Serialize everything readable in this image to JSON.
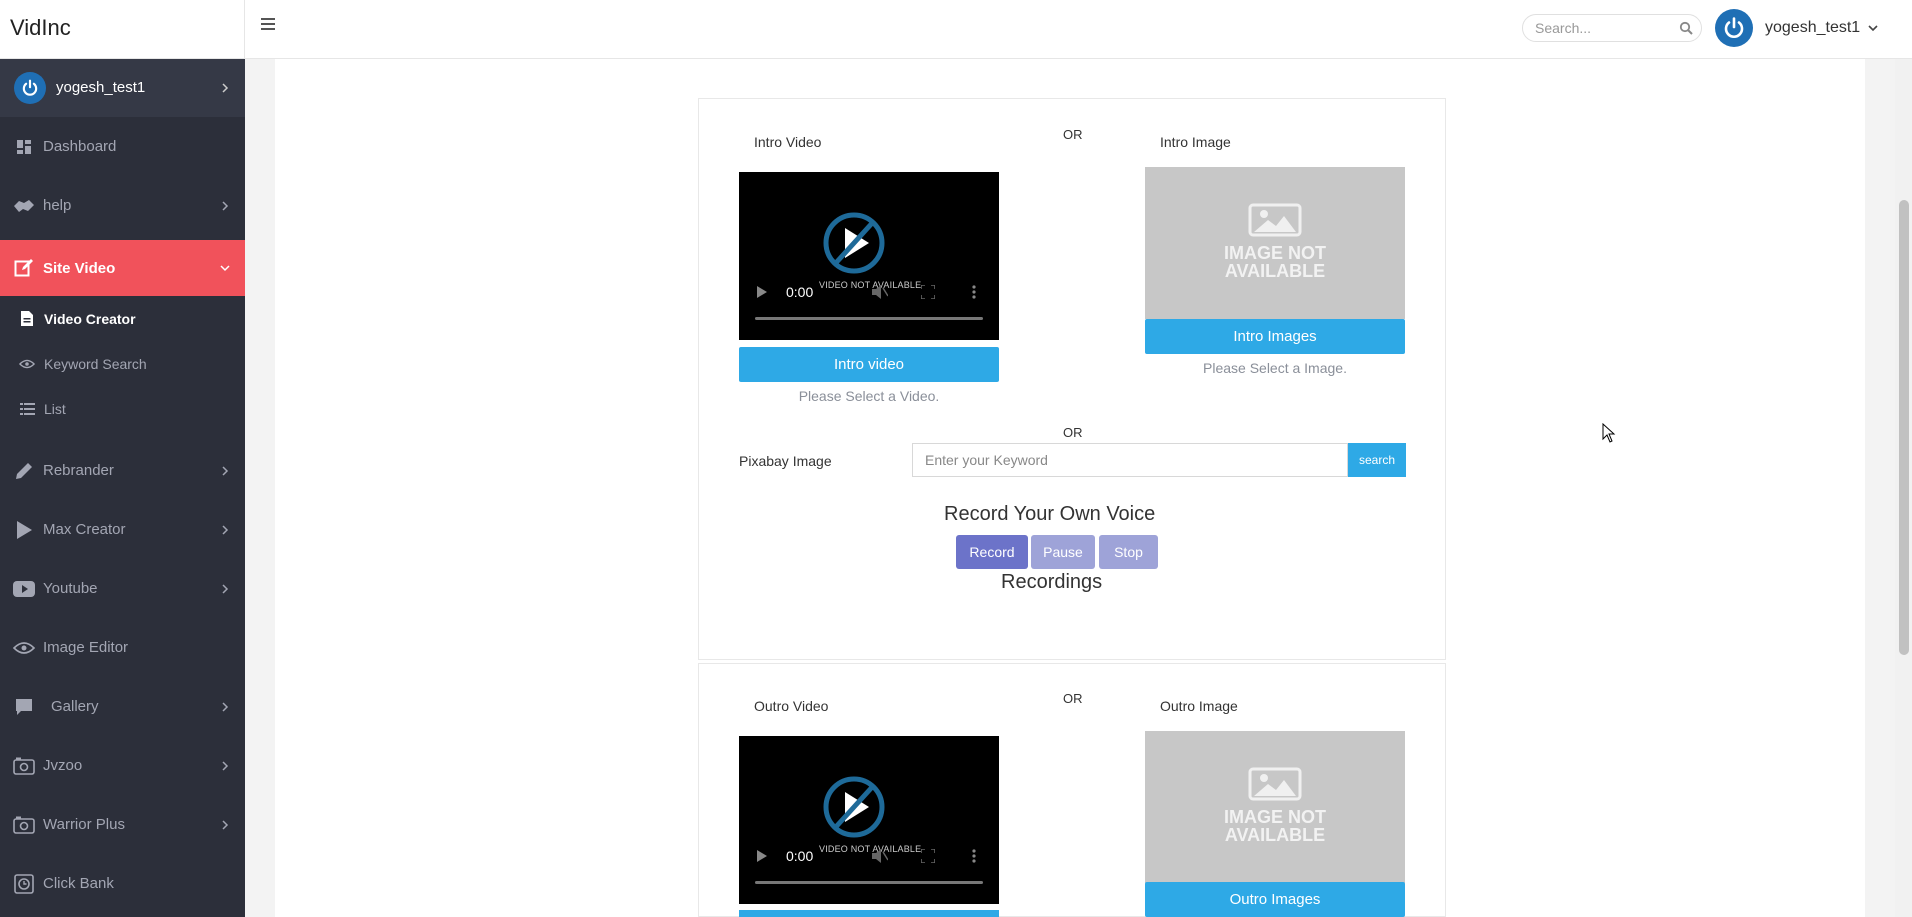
{
  "app": {
    "brand": "VidInc"
  },
  "topbar": {
    "search_placeholder": "Search...",
    "username": "yogesh_test1"
  },
  "sidebar": {
    "user": "yogesh_test1",
    "items": [
      {
        "label": "Dashboard",
        "icon": "dashboard-icon"
      },
      {
        "label": "help",
        "icon": "handshake-icon"
      },
      {
        "label": "Site Video",
        "icon": "edit-icon",
        "active": true
      },
      {
        "label": "Rebrander",
        "icon": "pencil-icon"
      },
      {
        "label": "Max Creator",
        "icon": "play-icon"
      },
      {
        "label": "Youtube",
        "icon": "youtube-icon"
      },
      {
        "label": "Image Editor",
        "icon": "eye-icon"
      },
      {
        "label": "Gallery",
        "icon": "comment-icon"
      },
      {
        "label": "Jvzoo",
        "icon": "camera-icon"
      },
      {
        "label": "Warrior Plus",
        "icon": "camera-icon"
      },
      {
        "label": "Click Bank",
        "icon": "clock-icon"
      }
    ],
    "subitems": [
      {
        "label": "Video Creator",
        "icon": "file-icon",
        "current": true
      },
      {
        "label": "Keyword Search",
        "icon": "eye-icon"
      },
      {
        "label": "List",
        "icon": "list-icon"
      }
    ]
  },
  "intro": {
    "video_label": "Intro Video",
    "or_top": "OR",
    "image_label": "Intro Image",
    "video_time": "0:00",
    "video_na": "VIDEO NOT AVAILABLE",
    "image_na_line1": "IMAGE NOT",
    "image_na_line2": "AVAILABLE",
    "video_button": "Intro video",
    "image_button": "Intro Images",
    "video_hint": "Please Select a Video.",
    "image_hint": "Please Select a Image.",
    "or_mid": "OR",
    "pixabay_label": "Pixabay Image",
    "keyword_placeholder": "Enter your Keyword",
    "search_button": "search",
    "voice_heading": "Record Your Own Voice",
    "record": "Record",
    "pause": "Pause",
    "stop": "Stop",
    "recordings": "Recordings"
  },
  "outro": {
    "video_label": "Outro Video",
    "or_top": "OR",
    "image_label": "Outro Image",
    "video_time": "0:00",
    "video_na": "VIDEO NOT AVAILABLE",
    "image_na_line1": "IMAGE NOT",
    "image_na_line2": "AVAILABLE",
    "image_button": "Outro Images"
  },
  "colors": {
    "sidebar_bg": "#2c2f3a",
    "active_item": "#f1525b",
    "primary_button": "#2ea9e6",
    "record_button": "#6c73c9",
    "disabled_button": "#9ea3d8"
  }
}
